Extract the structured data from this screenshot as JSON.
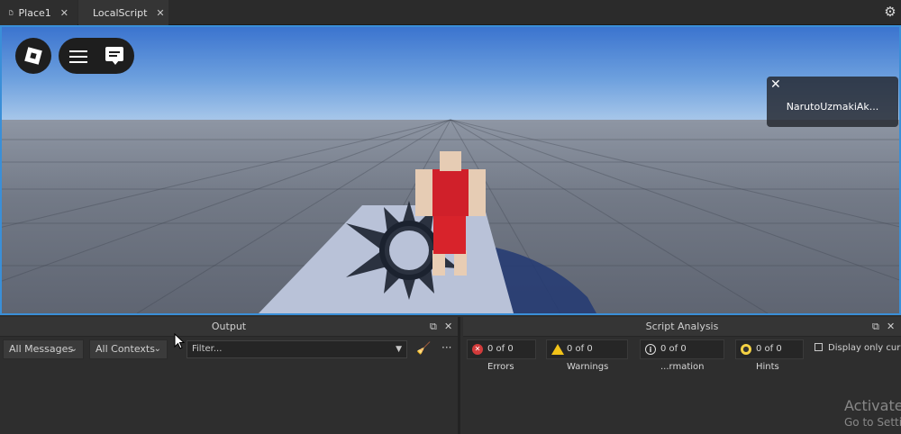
{
  "tabs": [
    {
      "label": "Place1",
      "icon": "place-file-icon",
      "close": "✕"
    },
    {
      "label": "LocalScript",
      "icon": "local-script-icon",
      "close": "✕"
    }
  ],
  "settings_icon": "gear-icon",
  "game": {
    "player_list": {
      "player_name": "NarutoUzmakiAk...",
      "close": "✕"
    }
  },
  "output_panel": {
    "title": "Output",
    "messages_dropdown": "All Messages",
    "contexts_dropdown": "All Contexts",
    "filter_placeholder": "Filter...",
    "more": "···"
  },
  "script_analysis_panel": {
    "title": "Script Analysis",
    "errors": "0 of 0 Errors",
    "warnings": "0 of 0 Warnings",
    "information": "0 of 0 ...rmation",
    "hints": "0 of 0 Hints",
    "display_only": "Display only curre"
  },
  "watermark": {
    "title": "Activate",
    "subtitle": "Go to Setti"
  },
  "colors": {
    "viewport_border": "#3a8fd8",
    "error": "#d33b3b",
    "warning": "#f2c318",
    "hint": "#f5d243"
  }
}
